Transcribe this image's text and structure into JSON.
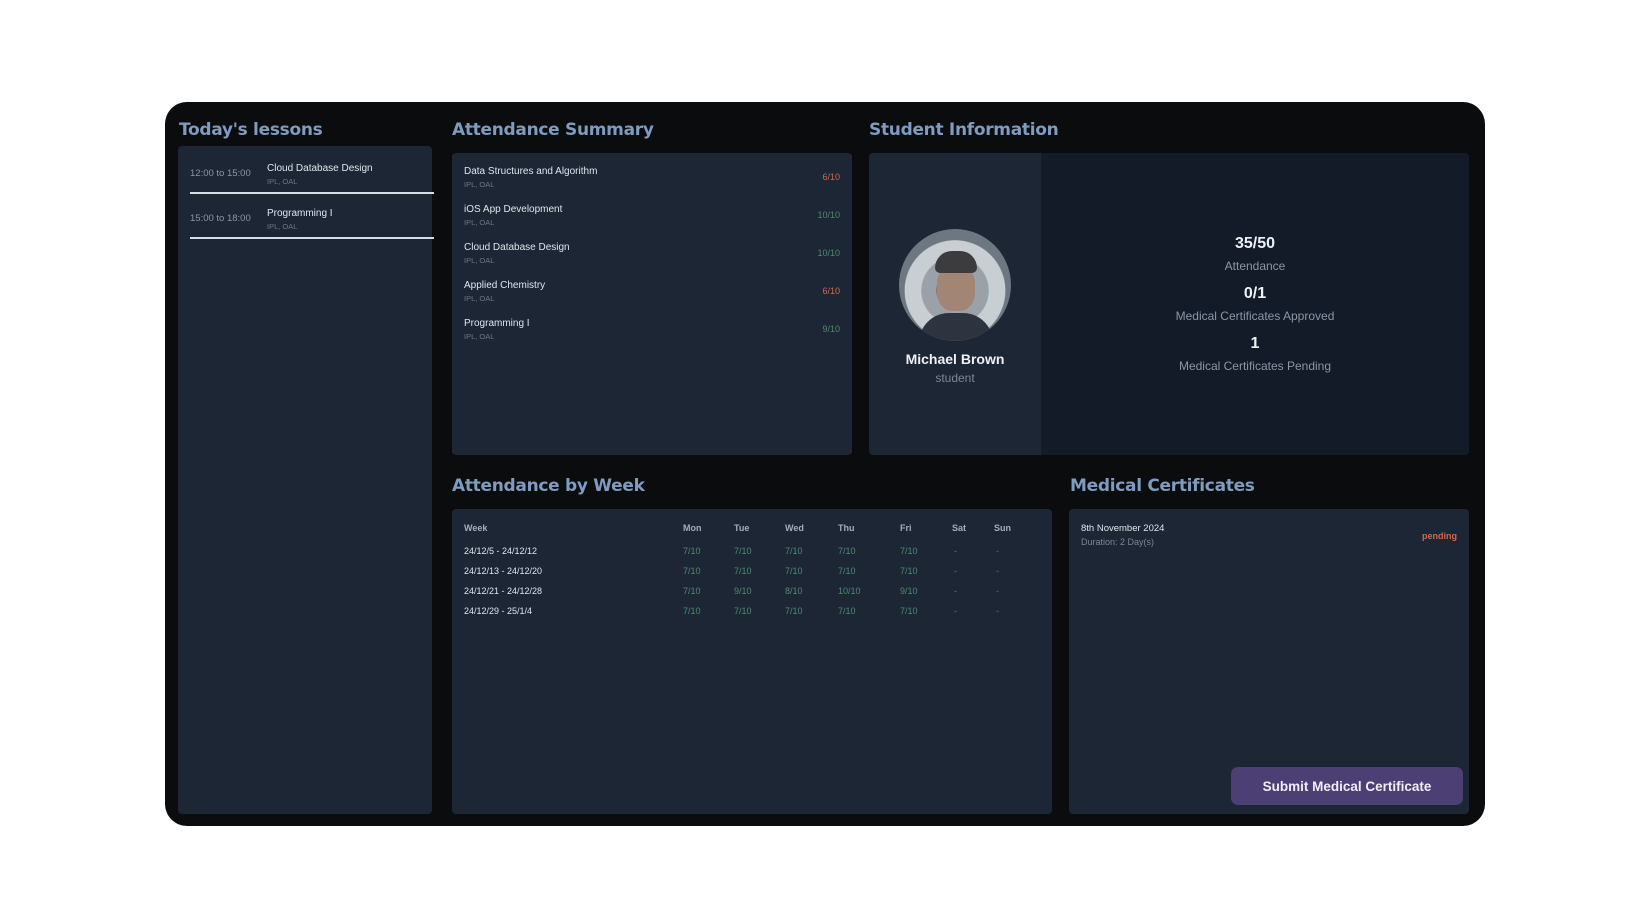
{
  "lessons": {
    "title": "Today's lessons",
    "items": [
      {
        "time": "12:00 to 15:00",
        "name": "Cloud Database Design",
        "sub": "IPL, OAL"
      },
      {
        "time": "15:00 to 18:00",
        "name": "Programming I",
        "sub": "IPL, OAL"
      }
    ]
  },
  "summary": {
    "title": "Attendance Summary",
    "items": [
      {
        "name": "Data Structures and Algorithm",
        "sub": "IPL, OAL",
        "value": "6/10",
        "status": "low"
      },
      {
        "name": "iOS App Development",
        "sub": "IPL, OAL",
        "value": "10/10",
        "status": "ok"
      },
      {
        "name": "Cloud Database Design",
        "sub": "IPL, OAL",
        "value": "10/10",
        "status": "ok"
      },
      {
        "name": "Applied Chemistry",
        "sub": "IPL, OAL",
        "value": "6/10",
        "status": "low"
      },
      {
        "name": "Programming I",
        "sub": "IPL, OAL",
        "value": "9/10",
        "status": "ok"
      }
    ]
  },
  "student": {
    "title": "Student Information",
    "name": "Michael Brown",
    "role": "student",
    "attendance_value": "35/50",
    "attendance_label": "Attendance",
    "approved_value": "0/1",
    "approved_label": "Medical Certificates Approved",
    "pending_value": "1",
    "pending_label": "Medical Certificates Pending"
  },
  "weekly": {
    "title": "Attendance by Week",
    "headers": [
      "Week",
      "Mon",
      "Tue",
      "Wed",
      "Thu",
      "Fri",
      "Sat",
      "Sun"
    ],
    "rows": [
      [
        "24/12/5 - 24/12/12",
        "7/10",
        "7/10",
        "7/10",
        "7/10",
        "7/10",
        "-",
        "-"
      ],
      [
        "24/12/13 - 24/12/20",
        "7/10",
        "7/10",
        "7/10",
        "7/10",
        "7/10",
        "-",
        "-"
      ],
      [
        "24/12/21 - 24/12/28",
        "7/10",
        "9/10",
        "8/10",
        "10/10",
        "9/10",
        "-",
        "-"
      ],
      [
        "24/12/29 - 25/1/4",
        "7/10",
        "7/10",
        "7/10",
        "7/10",
        "7/10",
        "-",
        "-"
      ]
    ]
  },
  "medical": {
    "title": "Medical Certificates",
    "items": [
      {
        "date": "8th November 2024",
        "duration_label": "Duration: 2 Day(s)",
        "status": "pending"
      }
    ],
    "submit_label": "Submit Medical Certificate"
  },
  "colors": {
    "app_bg": "#0b0c0e",
    "panel_bg": "#1d2634",
    "section_title": "#7f9bbf",
    "ok": "#4f8a74",
    "low": "#d0694d",
    "button": "#4c3f73"
  }
}
